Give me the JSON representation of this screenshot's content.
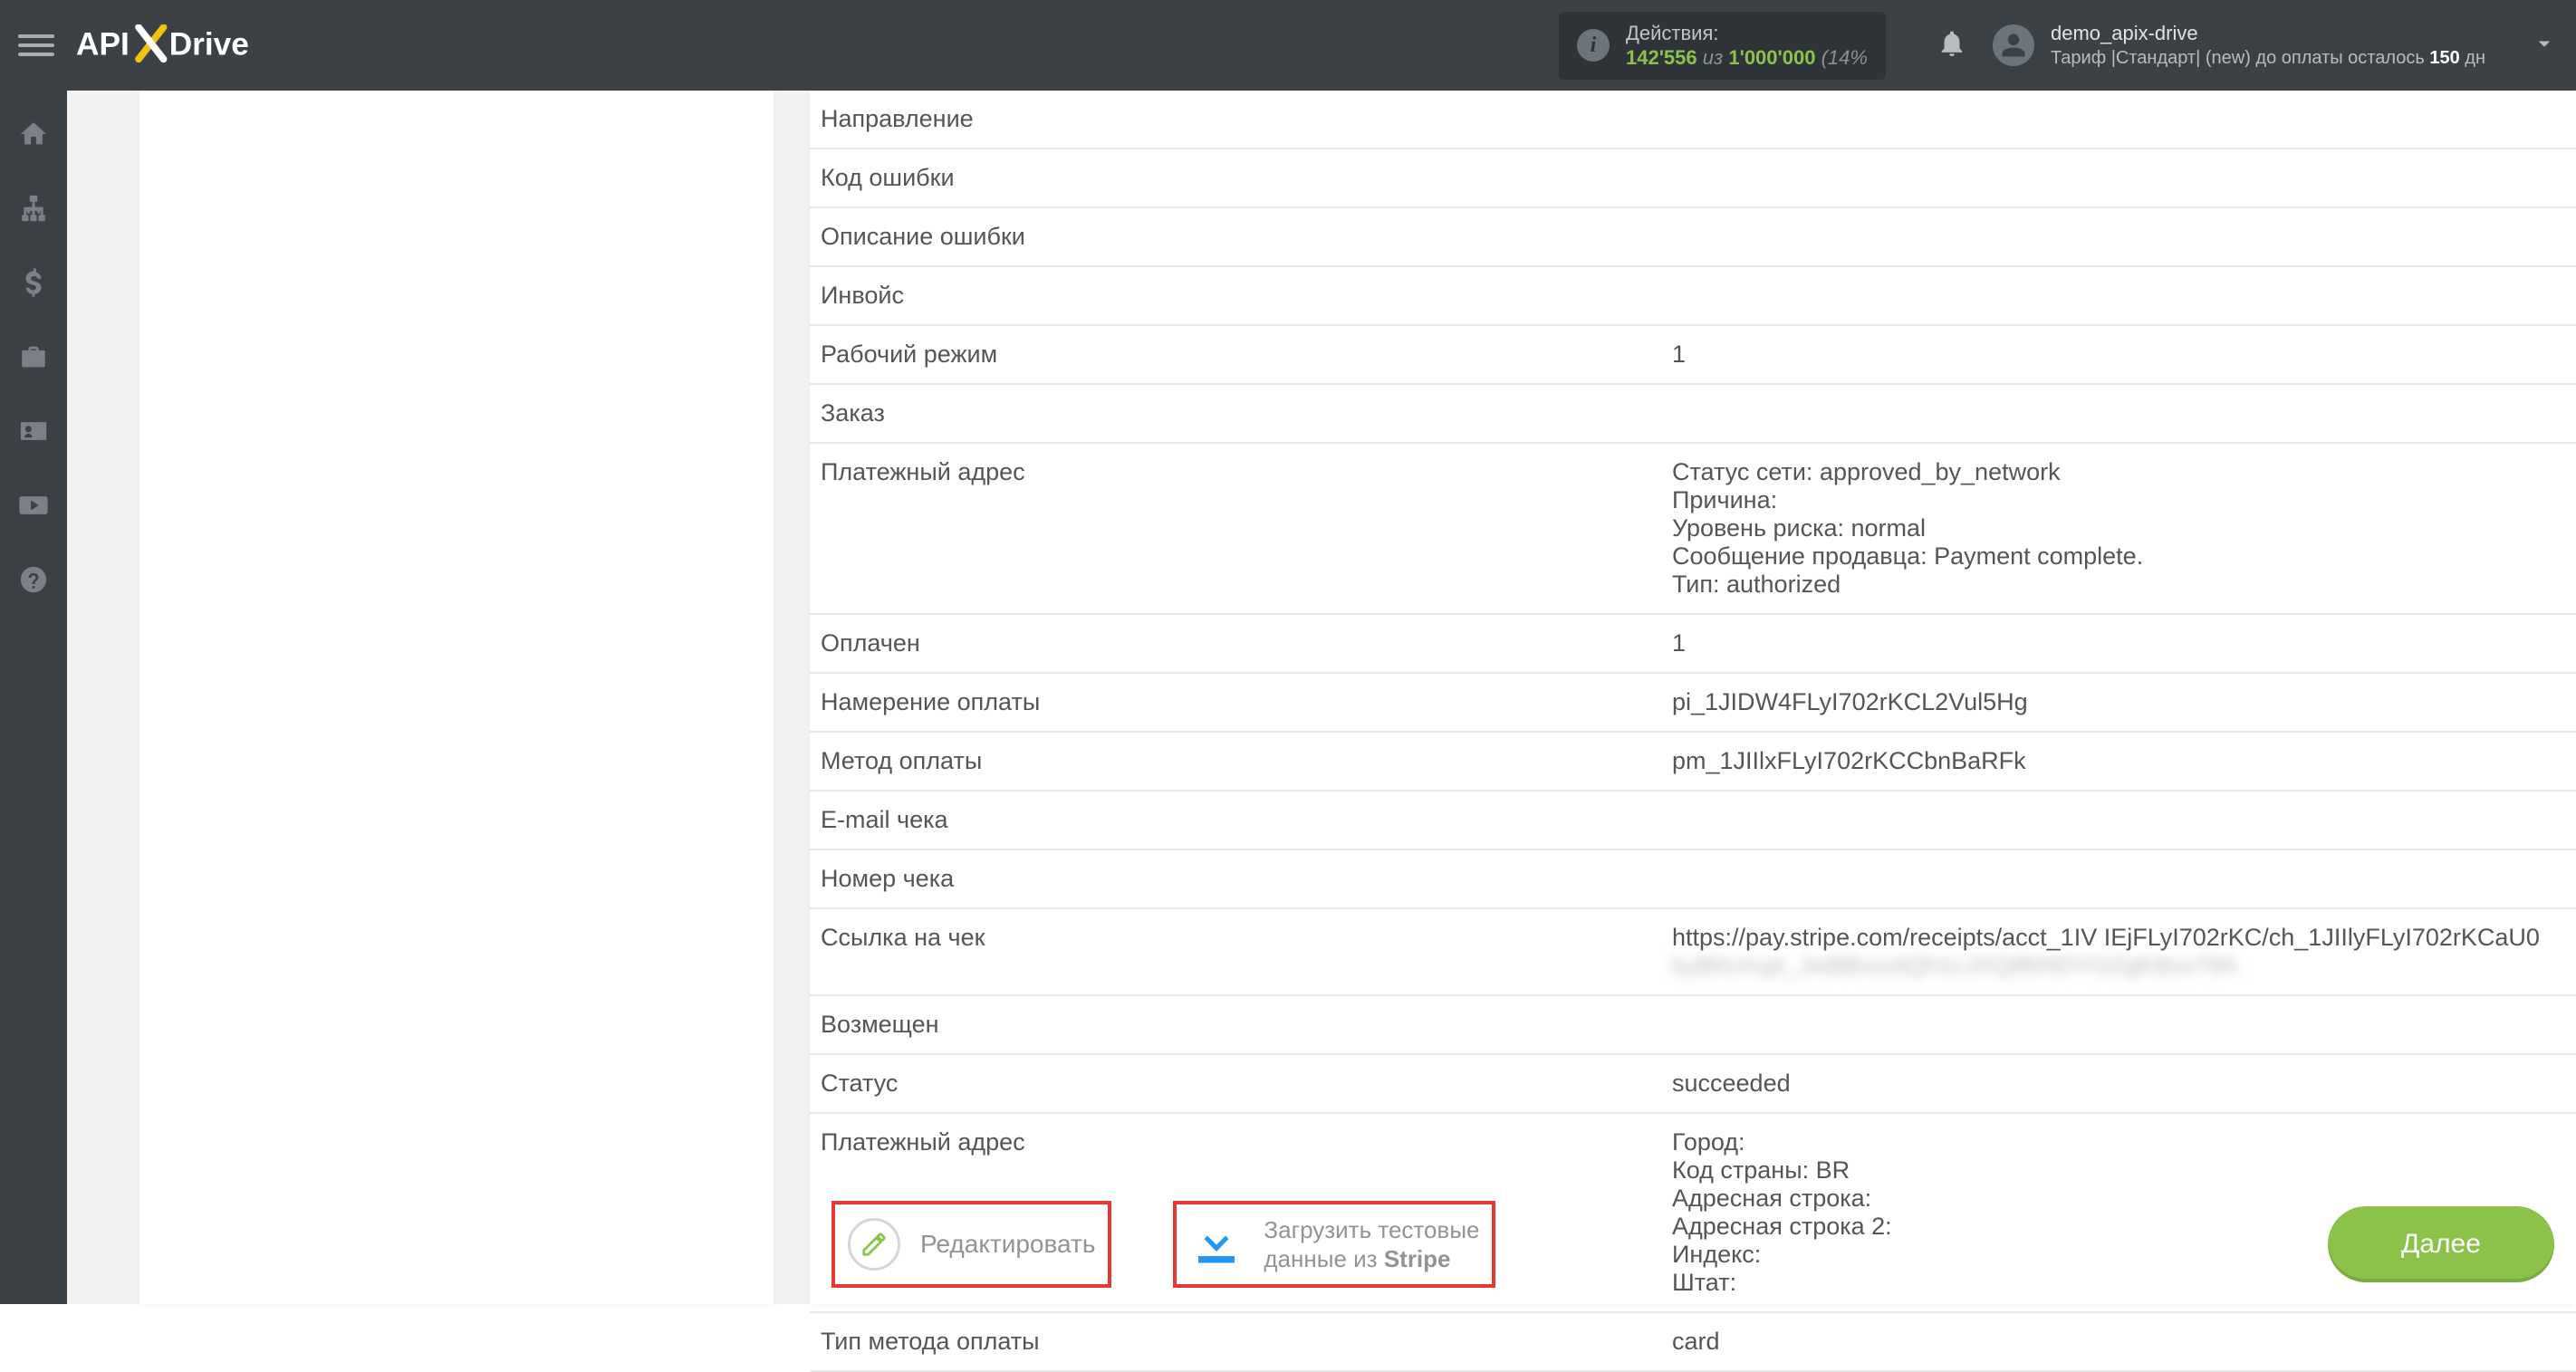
{
  "header": {
    "actions_label": "Действия:",
    "actions_used": "142'556",
    "actions_of": "из",
    "actions_total": "1'000'000",
    "actions_extra": "(14%",
    "username": "demo_apix-drive",
    "tariff_prefix": "Тариф |Стандарт| (new) до оплаты осталось ",
    "tariff_days": "150",
    "tariff_suffix": " дн"
  },
  "table": {
    "rows": [
      {
        "label": "Направление",
        "value": ""
      },
      {
        "label": "Код ошибки",
        "value": ""
      },
      {
        "label": "Описание ошибки",
        "value": ""
      },
      {
        "label": "Инвойс",
        "value": ""
      },
      {
        "label": "Рабочий режим",
        "value": "1"
      },
      {
        "label": "Заказ",
        "value": ""
      },
      {
        "label": "Платежный адрес",
        "value": "Статус сети: approved_by_network\nПричина:\nУровень риска: normal\nСообщение продавца: Payment complete.\nТип: authorized"
      },
      {
        "label": "Оплачен",
        "value": "1"
      },
      {
        "label": "Намерение оплаты",
        "value": "pi_1JIDW4FLyI702rKCL2Vul5Hg"
      },
      {
        "label": "Метод оплаты",
        "value": "pm_1JIIlxFLyI702rKCCbnBaRFk"
      },
      {
        "label": "E-mail чека",
        "value": ""
      },
      {
        "label": "Номер чека",
        "value": ""
      },
      {
        "label": "Ссылка на чек",
        "value": "https://pay.stripe.com/receipts/acct_1IV IEjFLyI702rKC/ch_1JIIlyFLyI702rKCaU0",
        "blurred_suffix": "kyBl/c/rcpt_JwBBxcotQh1cJXQtfbNDYGZgK8ox79A"
      },
      {
        "label": "Возмещен",
        "value": ""
      },
      {
        "label": "Статус",
        "value": "succeeded"
      },
      {
        "label": "Платежный адрес",
        "value": "Город:\nКод страны: BR\nАдресная строка:\nАдресная строка 2:\nИндекс:\nШтат:"
      },
      {
        "label": "Тип метода оплаты",
        "value": "card"
      }
    ]
  },
  "buttons": {
    "edit": "Редактировать",
    "load_line1": "Загрузить тестовые",
    "load_line2_prefix": "данные из ",
    "load_line2_bold": "Stripe",
    "next": "Далее"
  },
  "icons": {
    "home": "home-icon",
    "sitemap": "sitemap-icon",
    "dollar": "dollar-icon",
    "briefcase": "briefcase-icon",
    "idcard": "idcard-icon",
    "youtube": "youtube-icon",
    "help": "help-icon"
  }
}
